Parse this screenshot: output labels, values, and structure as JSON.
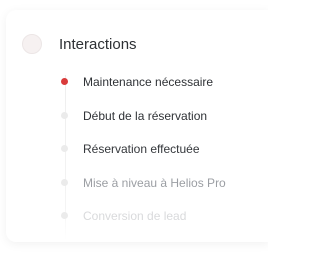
{
  "panel": {
    "title": "Interactions"
  },
  "timeline": {
    "items": [
      {
        "label": "Maintenance nécessaire",
        "active": true,
        "dot_color": "#d93b3b"
      },
      {
        "label": "Début de la réservation",
        "active": false
      },
      {
        "label": "Réservation effectuée",
        "active": false
      },
      {
        "label": "Mise à niveau à Helios Pro",
        "active": false
      },
      {
        "label": "Conversion de lead",
        "active": false
      }
    ]
  }
}
